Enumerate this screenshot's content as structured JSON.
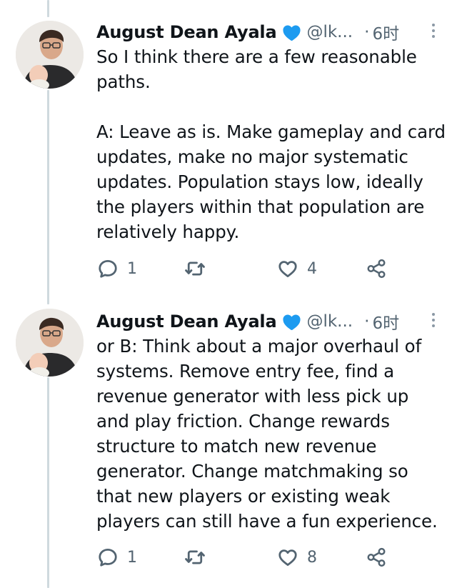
{
  "tweets": [
    {
      "author": "August Dean Ayala",
      "handle": "@lk...",
      "time_sep": "·",
      "time": "6时",
      "text": "So I think there are a few reasonable\npaths.\n\nA: Leave as is. Make gameplay and card\nupdates, make no major systematic\nupdates. Population stays low, ideally\nthe players within that population are\nrelatively happy.",
      "reply_count": "1",
      "retweet_count": "",
      "like_count": "4"
    },
    {
      "author": "August Dean Ayala",
      "handle": "@lk...",
      "time_sep": "·",
      "time": "6时",
      "text": "or B: Think about a major overhaul of\nsystems. Remove entry fee, find a\nrevenue generator with less pick up\nand play friction. Change rewards\nstructure to match new revenue\ngenerator. Change matchmaking so\nthat new players or existing weak\nplayers can still have a fun experience.",
      "reply_count": "1",
      "retweet_count": "",
      "like_count": "8"
    }
  ],
  "colors": {
    "verified": "#1d9bf0",
    "secondary_text": "#536471",
    "thread_line": "#cfd9de"
  },
  "icons": [
    "verified-badge-icon",
    "more-icon",
    "reply-icon",
    "retweet-icon",
    "like-icon",
    "share-icon"
  ]
}
